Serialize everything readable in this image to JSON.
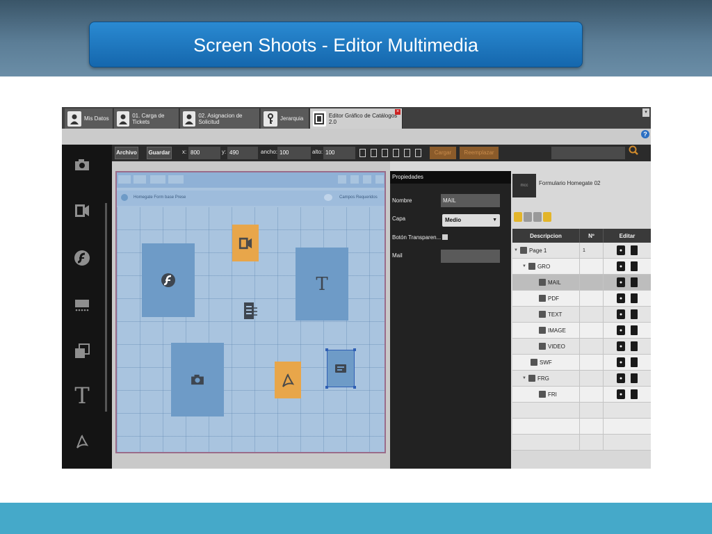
{
  "slide": {
    "title": "Screen Shoots - Editor Multimedia"
  },
  "tabs": [
    {
      "label": "Mis Datos"
    },
    {
      "label": "01. Carga de Tickets"
    },
    {
      "label": "02. Asignacion de Solicitud"
    },
    {
      "label": "Jerarquia"
    },
    {
      "label": "Editor Gráfico de Catálogos 2.0"
    }
  ],
  "toolbar": {
    "archivo": "Archivo",
    "guardar": "Guardar",
    "x_label": "x:",
    "x_value": "800",
    "y_label": "y:",
    "y_value": "490",
    "ancho_label": "ancho:",
    "ancho_value": "100",
    "alto_label": "alto:",
    "alto_value": "100",
    "cargar": "Cargar",
    "reemplazar": "Reemplazar"
  },
  "canvas": {
    "form_name": "Homegate Form base Prese",
    "required_fields": "Campos Requeridos"
  },
  "properties": {
    "header": "Propiedades",
    "nombre_label": "Nombre",
    "nombre_value": "MAIL",
    "capa_label": "Capa",
    "capa_value": "Medio",
    "boton_label": "Botón Transparen...",
    "mail_label": "Mail"
  },
  "tree": {
    "thumb_text": "mcc",
    "form_title": "Formulario Homegate 02",
    "headers": {
      "descripcion": "Descripcion",
      "numero": "Nº",
      "editar": "Editar"
    },
    "rows": [
      {
        "label": "Page 1",
        "num": "1"
      },
      {
        "label": "GRO",
        "num": ""
      },
      {
        "label": "MAIL",
        "num": ""
      },
      {
        "label": "PDF",
        "num": ""
      },
      {
        "label": "TEXT",
        "num": ""
      },
      {
        "label": "IMAGE",
        "num": ""
      },
      {
        "label": "VIDEO",
        "num": ""
      },
      {
        "label": "SWF",
        "num": ""
      },
      {
        "label": "FRG",
        "num": ""
      },
      {
        "label": "FRI",
        "num": ""
      }
    ]
  },
  "colors": {
    "title_box": "#1a73bf",
    "footer": "#45a9c9",
    "canvas_bg": "#a9c4df",
    "block_blue": "#6e9bc7",
    "block_orange": "#e8a64a"
  }
}
